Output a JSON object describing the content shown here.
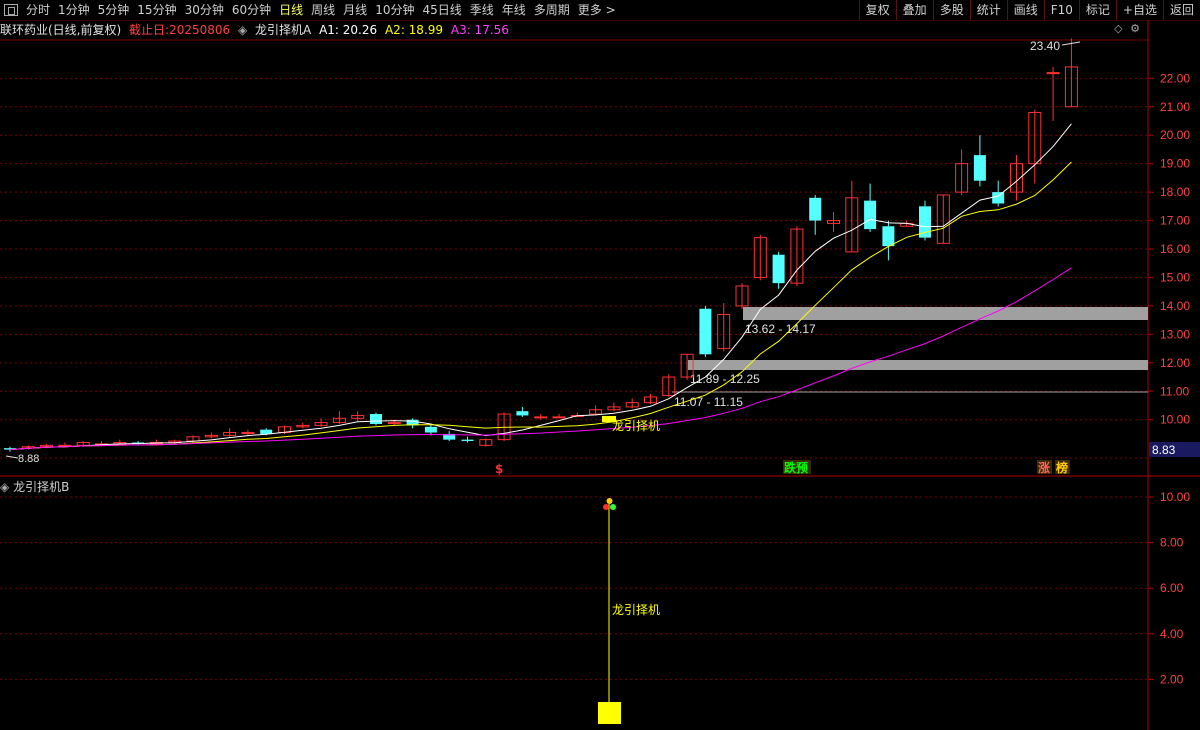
{
  "toolbar": {
    "menu_icon": "window-icon",
    "periods": [
      "分时",
      "1分钟",
      "5分钟",
      "15分钟",
      "30分钟",
      "60分钟",
      "日线",
      "周线",
      "月线",
      "10分钟",
      "45日线",
      "季线",
      "年线",
      "多周期",
      "更多 >"
    ],
    "active_period": "日线",
    "right_buttons": [
      "复权",
      "叠加",
      "多股",
      "统计",
      "画线",
      "F10",
      "标记",
      "+自选",
      "返回"
    ]
  },
  "info": {
    "stock_name": "联环药业(日线,前复权)",
    "cutoff_label": "截止日:20250806",
    "indicator_name": "龙引择机A",
    "a1": "A1: 20.26",
    "a2": "A2: 18.99",
    "a3": "A3: 17.56"
  },
  "main_chart": {
    "y_ticks": [
      "22.00",
      "21.00",
      "20.00",
      "19.00",
      "18.00",
      "17.00",
      "16.00",
      "15.00",
      "14.00",
      "13.00",
      "12.00",
      "11.00",
      "10.00"
    ],
    "last_price": "8.83",
    "low_label": "8.88",
    "high_label": "23.40",
    "zones": [
      {
        "label": "13.62 - 14.17"
      },
      {
        "label": "11.89 - 12.25"
      },
      {
        "label": "11.07 - 11.15"
      }
    ],
    "signal_label": "龙引择机",
    "markers": [
      {
        "text": "$",
        "color": "#ff3030"
      },
      {
        "text": "跌预",
        "color": "#00ff00"
      },
      {
        "text": "涨",
        "color": "#ff6060"
      },
      {
        "text": "榜",
        "color": "#ffcc00"
      }
    ]
  },
  "sub_chart": {
    "name": "龙引择机B",
    "y_ticks": [
      "10.00",
      "8.00",
      "6.00",
      "4.00",
      "2.00"
    ],
    "signal_label": "龙引择机"
  },
  "colors": {
    "up": "#ff3030",
    "down": "#54ffff",
    "ma1": "#ffffff",
    "ma2": "#ffff00",
    "ma3": "#ff00ff",
    "grid": "#7a0000"
  }
}
